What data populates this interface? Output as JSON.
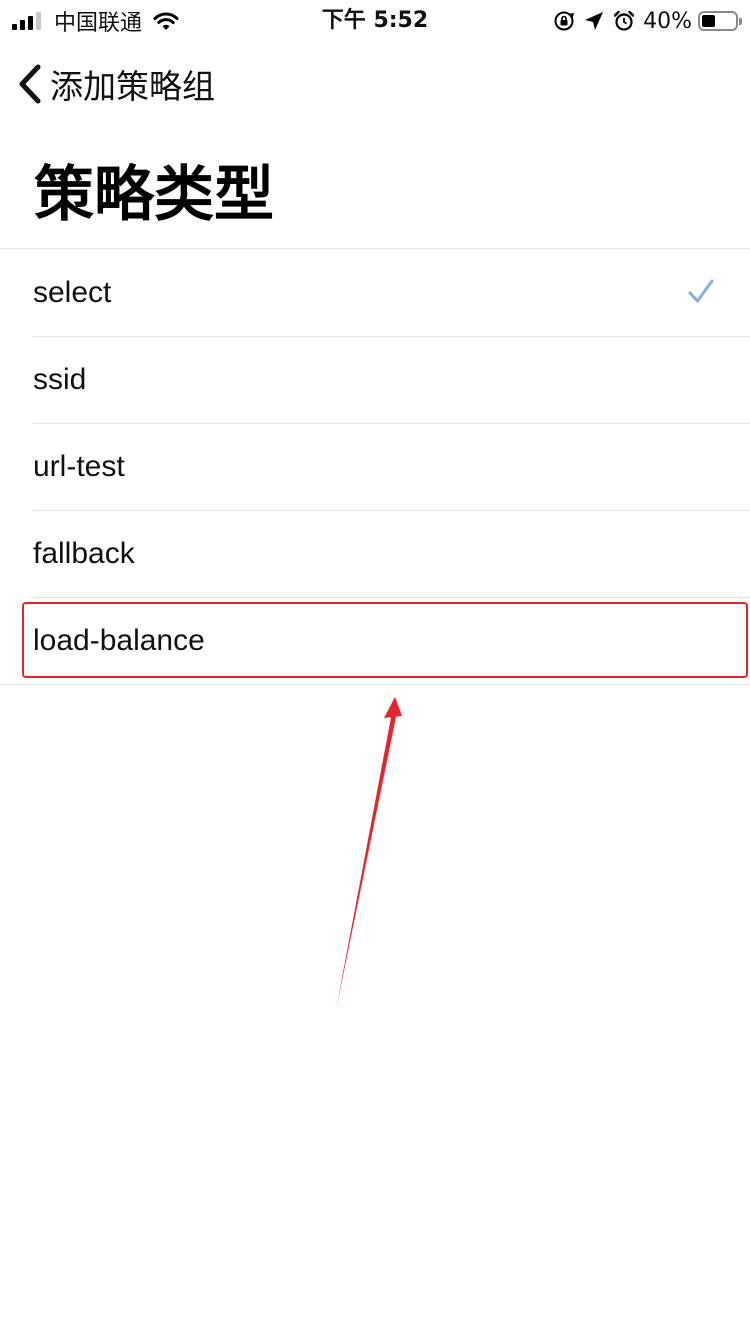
{
  "status_bar": {
    "carrier": "中国联通",
    "time": "下午 5:52",
    "battery_percent": "40%",
    "battery_level": 0.4,
    "icons": [
      "signal-icon",
      "wifi-icon",
      "orientation-lock-icon",
      "location-icon",
      "alarm-icon",
      "battery-icon"
    ]
  },
  "nav": {
    "back_label": "添加策略组"
  },
  "page": {
    "title": "策略类型"
  },
  "options": [
    {
      "label": "select",
      "selected": true
    },
    {
      "label": "ssid",
      "selected": false
    },
    {
      "label": "url-test",
      "selected": false
    },
    {
      "label": "fallback",
      "selected": false
    },
    {
      "label": "load-balance",
      "selected": false
    }
  ],
  "annotation": {
    "highlighted_option": "load-balance",
    "color": "#e8232a"
  },
  "colors": {
    "checkmark": "#7fb0e6",
    "separator": "#e2e2e2"
  }
}
